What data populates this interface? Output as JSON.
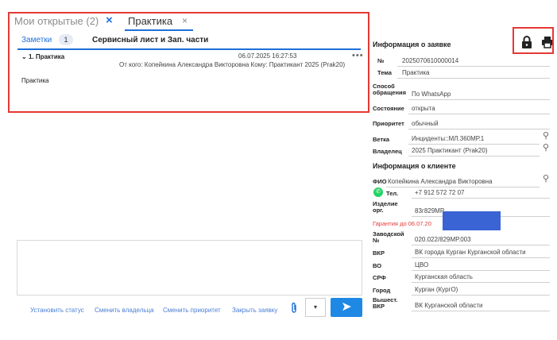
{
  "tabs": [
    {
      "label": "Мои открытые (2)",
      "close": "×"
    },
    {
      "label": "Практика",
      "close": "×"
    }
  ],
  "subtabs": {
    "notes_label": "Заметки",
    "notes_count": "1",
    "service_label": "Сервисный лист и Зап. части"
  },
  "note": {
    "title": "1. Практика",
    "date": "06.07.2025 16:27:53",
    "more": "•••",
    "meta": "От кого: Копейкина Александра Викторовна  Кому: Практикант 2025 (Prak20)",
    "body": "Практика"
  },
  "bottom_actions": [
    "Установить статус",
    "Сменить владельца",
    "Сменить приоритет",
    "Закрыть заявку"
  ],
  "dropdown_symbol": "▾",
  "send_symbol": "➤",
  "request_info": {
    "title": "Информация о заявке",
    "number_label": "№",
    "number_value": "2025070610000014",
    "topic_label": "Тема",
    "topic_value": "Практика",
    "method_label": "Способ обращения",
    "method_value": "По WhatsApp",
    "state_label": "Состояние",
    "state_value": "открыта",
    "priority_label": "Приоритет",
    "priority_value": "обычный",
    "branch_label": "Ветка",
    "branch_value": "Инциденты::МЛ.360МР.1",
    "owner_label": "Владелец",
    "owner_value": "2025 Практикант (Prak20)"
  },
  "client_info": {
    "title": "Информация о клиенте",
    "fio_label": "ФИО",
    "fio_value": "Копейкина Александра Викторовна",
    "phone_label": "Тел.",
    "phone_value": "+7 912 572 72 07",
    "product_label": "Изделие орг.",
    "product_value": "83г829МР",
    "warranty_text": "Гарантия до 06.07.20",
    "serial_label": "Заводской №",
    "serial_value": "020.022/829МР.003",
    "vkr_label": "ВКР",
    "vkr_value": "ВК города Курган Курганской области",
    "vo_label": "ВО",
    "vo_value": "ЦВО",
    "srf_label": "СРФ",
    "srf_value": "Курганская область",
    "city_label": "Город",
    "city_value": "Курган (КургО)",
    "higher_label": "Вышест. ВКР",
    "higher_value": "ВК Курганской области"
  },
  "colors": {
    "accent": "#1e6fd9",
    "highlight": "#e53935",
    "send": "#1e88e5",
    "whatsapp": "#25d366"
  }
}
